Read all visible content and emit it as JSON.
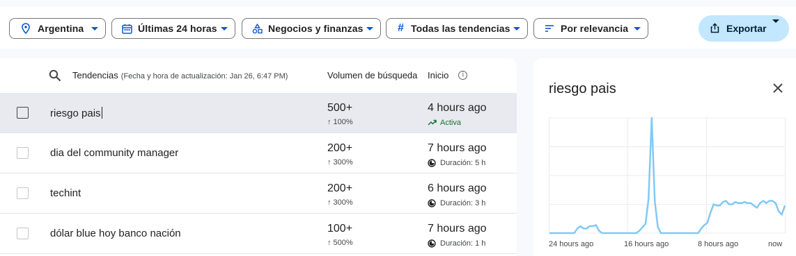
{
  "filters": {
    "country": "Argentina",
    "time": "Últimas 24 horas",
    "category": "Negocios y finanzas",
    "trends": "Todas las tendencias",
    "sort": "Por relevancia"
  },
  "export_label": "Exportar",
  "table": {
    "header_trends": "Tendencias",
    "header_updated": "(Fecha y hora de actualización: Jan 26, 6:47 PM)",
    "header_volume": "Volumen de búsqueda",
    "header_start": "Inicio",
    "info_glyph": "i",
    "rows": [
      {
        "name": "riesgo pais",
        "volume": "500+",
        "change": "↑ 100%",
        "ago": "4 hours ago",
        "status": "Activa"
      },
      {
        "name": "dia del community manager",
        "volume": "200+",
        "change": "↑ 300%",
        "ago": "7 hours ago",
        "status": "Duración: 5 h"
      },
      {
        "name": "techint",
        "volume": "200+",
        "change": "↑ 300%",
        "ago": "6 hours ago",
        "status": "Duración: 3 h"
      },
      {
        "name": "dólar blue hoy banco nación",
        "volume": "100+",
        "change": "↑ 500%",
        "ago": "7 hours ago",
        "status": "Duración: 1 h"
      }
    ]
  },
  "panel": {
    "title": "riesgo pais",
    "x_labels": [
      "24 hours ago",
      "16 hours ago",
      "8 hours ago",
      "now"
    ]
  },
  "chart_data": {
    "type": "line",
    "xlabel": "",
    "ylabel": "",
    "x_tick_labels": [
      "24 hours ago",
      "16 hours ago",
      "8 hours ago",
      "now"
    ],
    "ylim": [
      0,
      100
    ],
    "grid": true,
    "series": [
      {
        "values": [
          0,
          0,
          0,
          0,
          0,
          0,
          0,
          0,
          0,
          4,
          6,
          4,
          4,
          6,
          6,
          7,
          2,
          0,
          0,
          0,
          0,
          0,
          0,
          0,
          0,
          0,
          0,
          0,
          0,
          2,
          5,
          8,
          30,
          100,
          28,
          5,
          0,
          0,
          0,
          0,
          0,
          0,
          0,
          0,
          0,
          0,
          0,
          0,
          0,
          4,
          7,
          9,
          18,
          25,
          24,
          24,
          27,
          28,
          25,
          25,
          27,
          26,
          26,
          27,
          26,
          26,
          24,
          22,
          26,
          28,
          26,
          28,
          28,
          26,
          19,
          16,
          24
        ],
        "color": "#81c9f5"
      }
    ]
  },
  "colors": {
    "accent": "#0b57d0",
    "active": "#137333",
    "export_bg": "#c2e7ff",
    "selected_row": "#e8eaf0"
  }
}
